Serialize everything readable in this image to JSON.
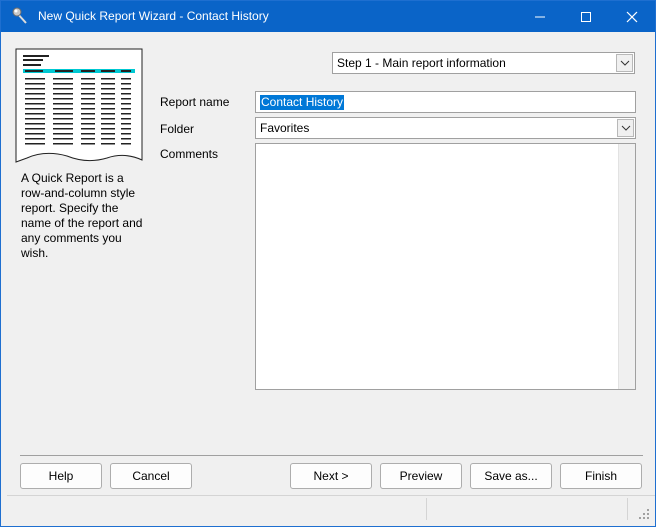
{
  "window": {
    "title": "New Quick Report Wizard - Contact History",
    "icon": "wizard-wand-icon",
    "controls": [
      "minimize-icon",
      "maximize-icon",
      "close-icon"
    ]
  },
  "sidebar": {
    "preview_icon": "report-preview-icon",
    "description": "A Quick Report is a row-and-column style report. Specify the name of the report and any comments you wish."
  },
  "step_selector": {
    "value": "Step 1 - Main report information"
  },
  "form": {
    "report_name": {
      "label": "Report name",
      "value": "Contact History"
    },
    "folder": {
      "label": "Folder",
      "value": "Favorites"
    },
    "comments": {
      "label": "Comments",
      "value": ""
    }
  },
  "buttons": {
    "help": "Help",
    "cancel": "Cancel",
    "next": "Next >",
    "preview": "Preview",
    "save_as": "Save as...",
    "finish": "Finish"
  },
  "colors": {
    "titlebar": "#0a64c8",
    "selection": "#0078d7",
    "preview_highlight": "#00c8d2"
  }
}
